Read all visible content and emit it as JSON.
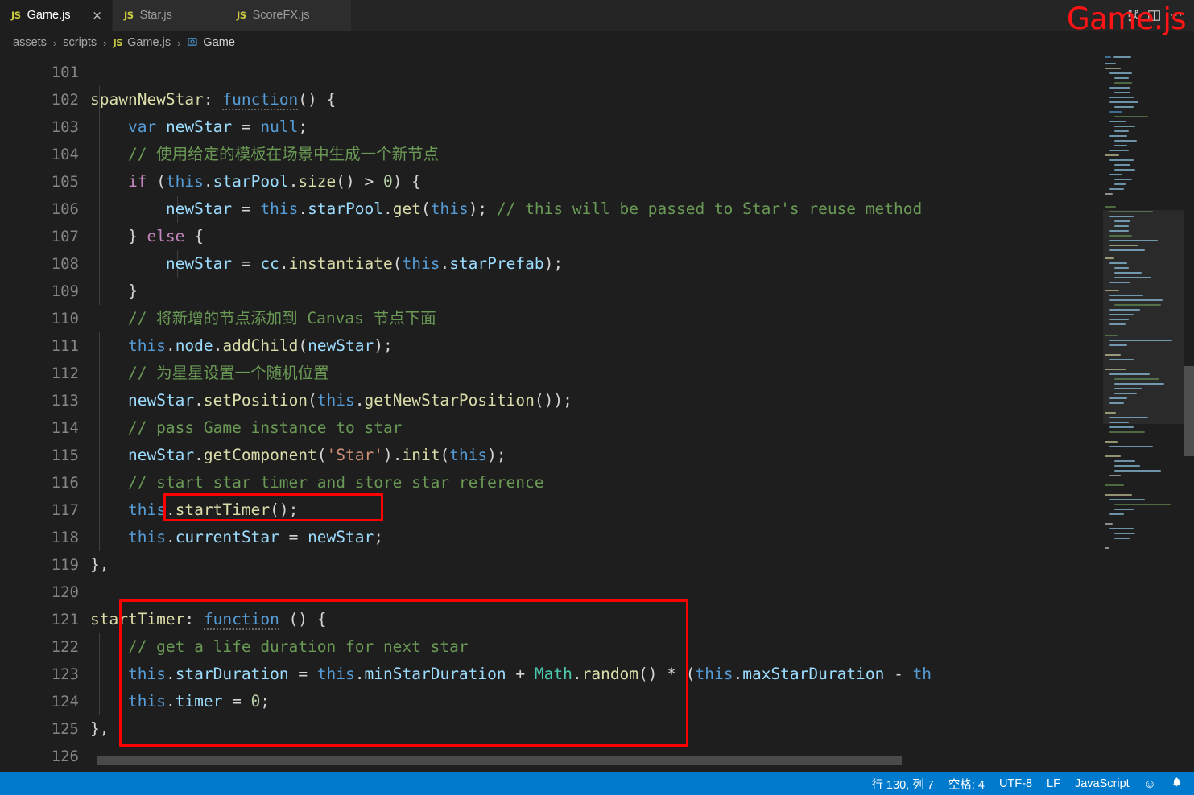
{
  "window": {
    "watermark_text": "Game.js",
    "watermark_color": "#ff1515",
    "editor_bg": "#1e1e1e",
    "accent": "#007acc"
  },
  "tabs": [
    {
      "icon": "js-file-icon",
      "badge": "JS",
      "label": "Game.js",
      "active": true,
      "close": "×"
    },
    {
      "icon": "js-file-icon",
      "badge": "JS",
      "label": "Star.js",
      "active": false,
      "close": ""
    },
    {
      "icon": "js-file-icon",
      "badge": "JS",
      "label": "ScoreFX.js",
      "active": false,
      "close": ""
    }
  ],
  "tabbar_actions": [
    {
      "name": "split-editor-icon",
      "glyph": "⎇"
    },
    {
      "name": "open-changes-icon",
      "glyph": "◫"
    },
    {
      "name": "more-actions-icon",
      "glyph": "⋯"
    }
  ],
  "breadcrumb": {
    "items": [
      {
        "label": "assets",
        "icon": ""
      },
      {
        "label": "scripts",
        "icon": ""
      },
      {
        "label": "Game.js",
        "icon": "js-badge",
        "badge": "JS"
      },
      {
        "label": "Game",
        "icon": "symbol-class-icon",
        "badge": "ⓘ"
      }
    ],
    "separator": "›"
  },
  "editor": {
    "first_line": 101,
    "line_height": 34,
    "lines": [
      {
        "n": 101,
        "text": ""
      },
      {
        "n": 102,
        "text": "spawnNewStar: function() {"
      },
      {
        "n": 103,
        "text": "    var newStar = null;"
      },
      {
        "n": 104,
        "text": "    // 使用给定的模板在场景中生成一个新节点"
      },
      {
        "n": 105,
        "text": "    if (this.starPool.size() > 0) {"
      },
      {
        "n": 106,
        "text": "        newStar = this.starPool.get(this); // this will be passed to Star's reuse method"
      },
      {
        "n": 107,
        "text": "    } else {"
      },
      {
        "n": 108,
        "text": "        newStar = cc.instantiate(this.starPrefab);"
      },
      {
        "n": 109,
        "text": "    }"
      },
      {
        "n": 110,
        "text": "    // 将新增的节点添加到 Canvas 节点下面"
      },
      {
        "n": 111,
        "text": "    this.node.addChild(newStar);"
      },
      {
        "n": 112,
        "text": "    // 为星星设置一个随机位置"
      },
      {
        "n": 113,
        "text": "    newStar.setPosition(this.getNewStarPosition());"
      },
      {
        "n": 114,
        "text": "    // pass Game instance to star"
      },
      {
        "n": 115,
        "text": "    newStar.getComponent('Star').init(this);"
      },
      {
        "n": 116,
        "text": "    // start star timer and store star reference"
      },
      {
        "n": 117,
        "text": "    this.startTimer();"
      },
      {
        "n": 118,
        "text": "    this.currentStar = newStar;"
      },
      {
        "n": 119,
        "text": "},"
      },
      {
        "n": 120,
        "text": ""
      },
      {
        "n": 121,
        "text": "startTimer: function () {"
      },
      {
        "n": 122,
        "text": "    // get a life duration for next star"
      },
      {
        "n": 123,
        "text": "    this.starDuration = this.minStarDuration + Math.random() * (this.maxStarDuration - th"
      },
      {
        "n": 124,
        "text": "    this.timer = 0;"
      },
      {
        "n": 125,
        "text": "},"
      },
      {
        "n": 126,
        "text": ""
      }
    ]
  },
  "annotations": [
    {
      "name": "redbox-start-timer-call",
      "target_line": 117,
      "label": "this.startTimer();"
    },
    {
      "name": "redbox-start-timer-function",
      "target_lines": "121-125",
      "label": "startTimer: function () { ... },"
    }
  ],
  "statusbar": {
    "items": [
      {
        "name": "cursor-position",
        "text": "行 130, 列 7"
      },
      {
        "name": "indentation",
        "text": "空格: 4"
      },
      {
        "name": "encoding",
        "text": "UTF-8"
      },
      {
        "name": "eol",
        "text": "LF"
      },
      {
        "name": "language-mode",
        "text": "JavaScript"
      },
      {
        "name": "feedback-smiley-icon",
        "text": "☺"
      },
      {
        "name": "notifications-bell-icon",
        "text": "🔔"
      }
    ]
  }
}
